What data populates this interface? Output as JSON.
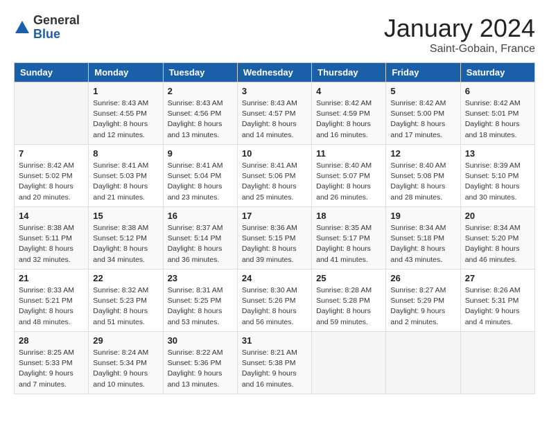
{
  "header": {
    "logo_general": "General",
    "logo_blue": "Blue",
    "month_title": "January 2024",
    "subtitle": "Saint-Gobain, France"
  },
  "days_of_week": [
    "Sunday",
    "Monday",
    "Tuesday",
    "Wednesday",
    "Thursday",
    "Friday",
    "Saturday"
  ],
  "weeks": [
    [
      {
        "day": "",
        "detail": ""
      },
      {
        "day": "1",
        "detail": "Sunrise: 8:43 AM\nSunset: 4:55 PM\nDaylight: 8 hours\nand 12 minutes."
      },
      {
        "day": "2",
        "detail": "Sunrise: 8:43 AM\nSunset: 4:56 PM\nDaylight: 8 hours\nand 13 minutes."
      },
      {
        "day": "3",
        "detail": "Sunrise: 8:43 AM\nSunset: 4:57 PM\nDaylight: 8 hours\nand 14 minutes."
      },
      {
        "day": "4",
        "detail": "Sunrise: 8:42 AM\nSunset: 4:59 PM\nDaylight: 8 hours\nand 16 minutes."
      },
      {
        "day": "5",
        "detail": "Sunrise: 8:42 AM\nSunset: 5:00 PM\nDaylight: 8 hours\nand 17 minutes."
      },
      {
        "day": "6",
        "detail": "Sunrise: 8:42 AM\nSunset: 5:01 PM\nDaylight: 8 hours\nand 18 minutes."
      }
    ],
    [
      {
        "day": "7",
        "detail": "Sunrise: 8:42 AM\nSunset: 5:02 PM\nDaylight: 8 hours\nand 20 minutes."
      },
      {
        "day": "8",
        "detail": "Sunrise: 8:41 AM\nSunset: 5:03 PM\nDaylight: 8 hours\nand 21 minutes."
      },
      {
        "day": "9",
        "detail": "Sunrise: 8:41 AM\nSunset: 5:04 PM\nDaylight: 8 hours\nand 23 minutes."
      },
      {
        "day": "10",
        "detail": "Sunrise: 8:41 AM\nSunset: 5:06 PM\nDaylight: 8 hours\nand 25 minutes."
      },
      {
        "day": "11",
        "detail": "Sunrise: 8:40 AM\nSunset: 5:07 PM\nDaylight: 8 hours\nand 26 minutes."
      },
      {
        "day": "12",
        "detail": "Sunrise: 8:40 AM\nSunset: 5:08 PM\nDaylight: 8 hours\nand 28 minutes."
      },
      {
        "day": "13",
        "detail": "Sunrise: 8:39 AM\nSunset: 5:10 PM\nDaylight: 8 hours\nand 30 minutes."
      }
    ],
    [
      {
        "day": "14",
        "detail": "Sunrise: 8:38 AM\nSunset: 5:11 PM\nDaylight: 8 hours\nand 32 minutes."
      },
      {
        "day": "15",
        "detail": "Sunrise: 8:38 AM\nSunset: 5:12 PM\nDaylight: 8 hours\nand 34 minutes."
      },
      {
        "day": "16",
        "detail": "Sunrise: 8:37 AM\nSunset: 5:14 PM\nDaylight: 8 hours\nand 36 minutes."
      },
      {
        "day": "17",
        "detail": "Sunrise: 8:36 AM\nSunset: 5:15 PM\nDaylight: 8 hours\nand 39 minutes."
      },
      {
        "day": "18",
        "detail": "Sunrise: 8:35 AM\nSunset: 5:17 PM\nDaylight: 8 hours\nand 41 minutes."
      },
      {
        "day": "19",
        "detail": "Sunrise: 8:34 AM\nSunset: 5:18 PM\nDaylight: 8 hours\nand 43 minutes."
      },
      {
        "day": "20",
        "detail": "Sunrise: 8:34 AM\nSunset: 5:20 PM\nDaylight: 8 hours\nand 46 minutes."
      }
    ],
    [
      {
        "day": "21",
        "detail": "Sunrise: 8:33 AM\nSunset: 5:21 PM\nDaylight: 8 hours\nand 48 minutes."
      },
      {
        "day": "22",
        "detail": "Sunrise: 8:32 AM\nSunset: 5:23 PM\nDaylight: 8 hours\nand 51 minutes."
      },
      {
        "day": "23",
        "detail": "Sunrise: 8:31 AM\nSunset: 5:25 PM\nDaylight: 8 hours\nand 53 minutes."
      },
      {
        "day": "24",
        "detail": "Sunrise: 8:30 AM\nSunset: 5:26 PM\nDaylight: 8 hours\nand 56 minutes."
      },
      {
        "day": "25",
        "detail": "Sunrise: 8:28 AM\nSunset: 5:28 PM\nDaylight: 8 hours\nand 59 minutes."
      },
      {
        "day": "26",
        "detail": "Sunrise: 8:27 AM\nSunset: 5:29 PM\nDaylight: 9 hours\nand 2 minutes."
      },
      {
        "day": "27",
        "detail": "Sunrise: 8:26 AM\nSunset: 5:31 PM\nDaylight: 9 hours\nand 4 minutes."
      }
    ],
    [
      {
        "day": "28",
        "detail": "Sunrise: 8:25 AM\nSunset: 5:33 PM\nDaylight: 9 hours\nand 7 minutes."
      },
      {
        "day": "29",
        "detail": "Sunrise: 8:24 AM\nSunset: 5:34 PM\nDaylight: 9 hours\nand 10 minutes."
      },
      {
        "day": "30",
        "detail": "Sunrise: 8:22 AM\nSunset: 5:36 PM\nDaylight: 9 hours\nand 13 minutes."
      },
      {
        "day": "31",
        "detail": "Sunrise: 8:21 AM\nSunset: 5:38 PM\nDaylight: 9 hours\nand 16 minutes."
      },
      {
        "day": "",
        "detail": ""
      },
      {
        "day": "",
        "detail": ""
      },
      {
        "day": "",
        "detail": ""
      }
    ]
  ]
}
